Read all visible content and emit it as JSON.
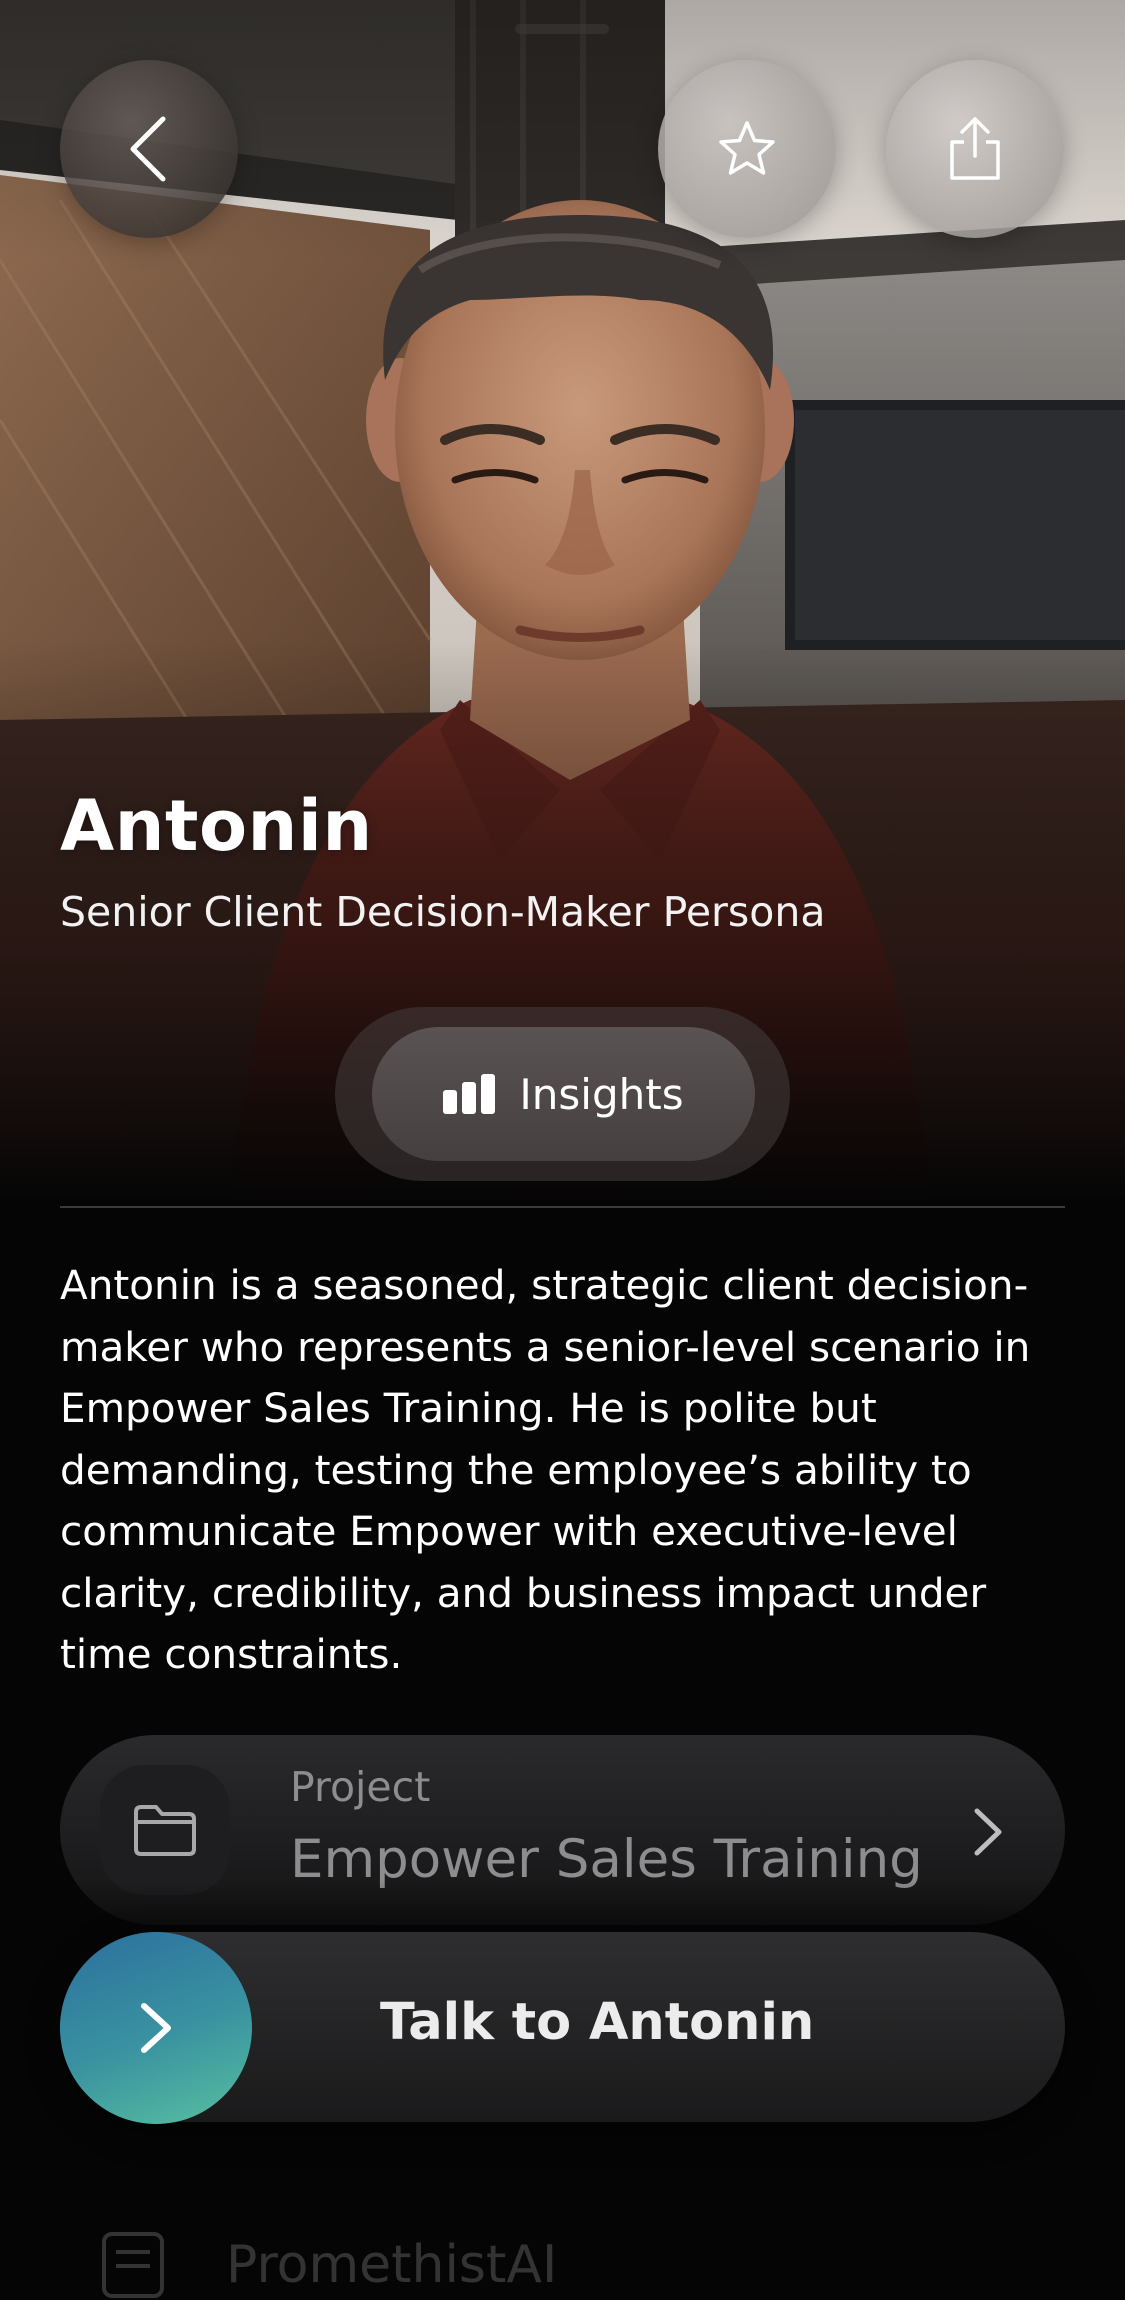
{
  "header": {
    "back_icon": "chevron-left-icon",
    "favorite_icon": "star-icon",
    "share_icon": "share-icon"
  },
  "persona": {
    "name": "Antonin",
    "subtitle": "Senior Client Decision-Maker Persona",
    "description": "Antonin is a seasoned, strategic client decision-maker who represents a senior-level scenario in Empower Sales Training. He is polite but demanding, testing the employee’s ability to communicate Empower with executive-level clarity, credibility, and business impact under time constraints."
  },
  "insights": {
    "label": "Insights",
    "icon": "bar-chart-icon"
  },
  "project": {
    "label": "Project",
    "name": "Empower Sales Training",
    "icon": "folder-icon"
  },
  "talk": {
    "label": "Talk to Antonin",
    "icon": "chevron-right-icon"
  },
  "partial_item": {
    "label": "PromethistAI",
    "icon": "document-icon"
  },
  "colors": {
    "background": "#050505",
    "talk_gradient_start": "#2b6f9e",
    "talk_gradient_end": "#57c0a0"
  }
}
